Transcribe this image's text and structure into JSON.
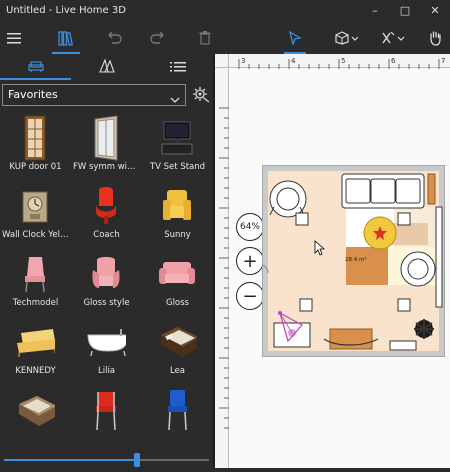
{
  "window": {
    "title": "Untitled - Live Home 3D"
  },
  "toolbar": {
    "menu_icon": "hamburger-icon",
    "library_icon": "books-icon",
    "undo_icon": "undo-icon",
    "redo_icon": "redo-icon",
    "delete_icon": "trash-icon",
    "select_icon": "cursor-icon",
    "view_icon": "3d-view-icon",
    "tools_icon": "tools-icon",
    "pan_icon": "hand-icon"
  },
  "sidebar": {
    "tabs": [
      {
        "icon": "sofa-icon",
        "active": true
      },
      {
        "icon": "materials-icon",
        "active": false
      },
      {
        "icon": "list-icon",
        "active": false
      }
    ],
    "category": "Favorites",
    "items": [
      {
        "label": "KUP door 01",
        "icon": "door-icon"
      },
      {
        "label": "FW symm wind...",
        "icon": "window-icon"
      },
      {
        "label": "TV Set Stand",
        "icon": "tv-stand-icon"
      },
      {
        "label": "Wall Clock Yello...",
        "icon": "wall-clock-icon"
      },
      {
        "label": "Coach",
        "icon": "red-chair-icon"
      },
      {
        "label": "Sunny",
        "icon": "yellow-armchair-icon"
      },
      {
        "label": "Techmodel",
        "icon": "pink-chair-icon"
      },
      {
        "label": "Gloss style",
        "icon": "pink-armchair-icon"
      },
      {
        "label": "Gloss",
        "icon": "pink-sofa-icon"
      },
      {
        "label": "KENNEDY",
        "icon": "yellow-sofa-icon"
      },
      {
        "label": "Lilia",
        "icon": "bathtub-icon"
      },
      {
        "label": "Lea",
        "icon": "bed-icon"
      },
      {
        "label": "",
        "icon": "bed-icon"
      },
      {
        "label": "",
        "icon": "red-chair-icon"
      },
      {
        "label": "",
        "icon": "blue-chair-icon"
      }
    ],
    "zoom_slider": {
      "value": 0.65
    }
  },
  "canvas": {
    "zoom_label": "64%",
    "zoom_in": "+",
    "zoom_out": "−",
    "room_area": "28.4 m²"
  },
  "colors": {
    "accent": "#3b8fe0",
    "floor": "#f9e3cc",
    "rug_orange": "#d8904a",
    "rug_cream": "#fdf6da"
  }
}
